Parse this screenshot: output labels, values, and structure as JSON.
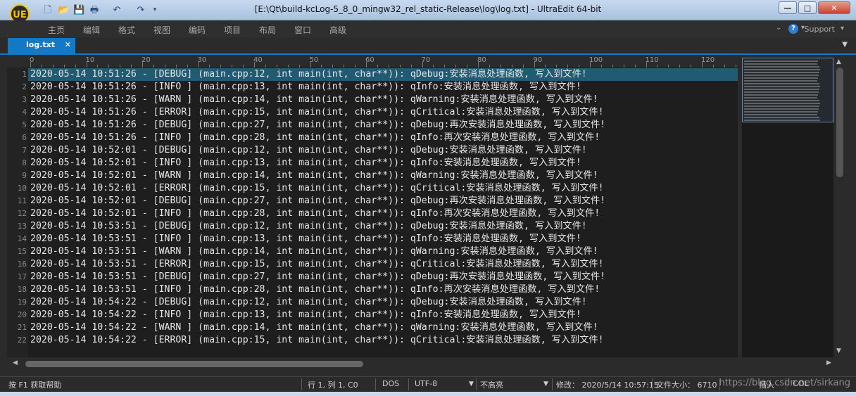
{
  "window": {
    "title": "[E:\\Qt\\build-kcLog-5_8_0_mingw32_rel_static-Release\\log\\log.txt] - UltraEdit 64-bit",
    "logo_text": "UE",
    "controls": {
      "minimize": "—",
      "maximize": "□",
      "close": "✕"
    }
  },
  "quick_access": [
    "new-file-icon",
    "open-folder-icon",
    "save-icon",
    "print-icon",
    "undo-icon",
    "redo-icon"
  ],
  "menu": {
    "items": [
      "主页",
      "编辑",
      "格式",
      "视图",
      "编码",
      "项目",
      "布局",
      "窗口",
      "高级"
    ],
    "support_label": "Support",
    "help_label": "?"
  },
  "tabs": [
    {
      "label": "log.txt",
      "close": "✕"
    }
  ],
  "ruler": {
    "labels": [
      "0",
      "10",
      "20",
      "30",
      "40",
      "50",
      "60",
      "70",
      "80",
      "90",
      "100",
      "110",
      "120"
    ]
  },
  "editor": {
    "line_numbers": [
      "1",
      "2",
      "3",
      "4",
      "5",
      "6",
      "7",
      "8",
      "9",
      "10",
      "11",
      "12",
      "13",
      "14",
      "15",
      "16",
      "17",
      "18",
      "19",
      "20",
      "21",
      "22"
    ],
    "lines": [
      "2020-05-14 10:51:26 - [DEBUG] (main.cpp:12, int main(int, char**)): qDebug:安装消息处理函数, 写入到文件!",
      "2020-05-14 10:51:26 - [INFO ] (main.cpp:13, int main(int, char**)): qInfo:安装消息处理函数, 写入到文件!",
      "2020-05-14 10:51:26 - [WARN ] (main.cpp:14, int main(int, char**)): qWarning:安装消息处理函数, 写入到文件!",
      "2020-05-14 10:51:26 - [ERROR] (main.cpp:15, int main(int, char**)): qCritical:安装消息处理函数, 写入到文件!",
      "2020-05-14 10:51:26 - [DEBUG] (main.cpp:27, int main(int, char**)): qDebug:再次安装消息处理函数, 写入到文件!",
      "2020-05-14 10:51:26 - [INFO ] (main.cpp:28, int main(int, char**)): qInfo:再次安装消息处理函数, 写入到文件!",
      "2020-05-14 10:52:01 - [DEBUG] (main.cpp:12, int main(int, char**)): qDebug:安装消息处理函数, 写入到文件!",
      "2020-05-14 10:52:01 - [INFO ] (main.cpp:13, int main(int, char**)): qInfo:安装消息处理函数, 写入到文件!",
      "2020-05-14 10:52:01 - [WARN ] (main.cpp:14, int main(int, char**)): qWarning:安装消息处理函数, 写入到文件!",
      "2020-05-14 10:52:01 - [ERROR] (main.cpp:15, int main(int, char**)): qCritical:安装消息处理函数, 写入到文件!",
      "2020-05-14 10:52:01 - [DEBUG] (main.cpp:27, int main(int, char**)): qDebug:再次安装消息处理函数, 写入到文件!",
      "2020-05-14 10:52:01 - [INFO ] (main.cpp:28, int main(int, char**)): qInfo:再次安装消息处理函数, 写入到文件!",
      "2020-05-14 10:53:51 - [DEBUG] (main.cpp:12, int main(int, char**)): qDebug:安装消息处理函数, 写入到文件!",
      "2020-05-14 10:53:51 - [INFO ] (main.cpp:13, int main(int, char**)): qInfo:安装消息处理函数, 写入到文件!",
      "2020-05-14 10:53:51 - [WARN ] (main.cpp:14, int main(int, char**)): qWarning:安装消息处理函数, 写入到文件!",
      "2020-05-14 10:53:51 - [ERROR] (main.cpp:15, int main(int, char**)): qCritical:安装消息处理函数, 写入到文件!",
      "2020-05-14 10:53:51 - [DEBUG] (main.cpp:27, int main(int, char**)): qDebug:再次安装消息处理函数, 写入到文件!",
      "2020-05-14 10:53:51 - [INFO ] (main.cpp:28, int main(int, char**)): qInfo:再次安装消息处理函数, 写入到文件!",
      "2020-05-14 10:54:22 - [DEBUG] (main.cpp:12, int main(int, char**)): qDebug:安装消息处理函数, 写入到文件!",
      "2020-05-14 10:54:22 - [INFO ] (main.cpp:13, int main(int, char**)): qInfo:安装消息处理函数, 写入到文件!",
      "2020-05-14 10:54:22 - [WARN ] (main.cpp:14, int main(int, char**)): qWarning:安装消息处理函数, 写入到文件!",
      "2020-05-14 10:54:22 - [ERROR] (main.cpp:15, int main(int, char**)): qCritical:安装消息处理函数, 写入到文件!"
    ]
  },
  "statusbar": {
    "help": "按 F1 获取帮助",
    "position": "行 1, 列 1, C0",
    "line_ending": "DOS",
    "encoding": "UTF-8",
    "highlight": "不高亮",
    "modified": "修改： 2020/5/14 10:57:15",
    "filesize": "文件大小： 6710",
    "mode_insert": "插入",
    "mode_col": "COL"
  },
  "watermark": "https://blog.csdn.net/sirkang",
  "colors": {
    "accent": "#1479c4",
    "current_line": "#205a73",
    "editor_bg": "#1e1e1e",
    "text": "#e6e6e6"
  }
}
